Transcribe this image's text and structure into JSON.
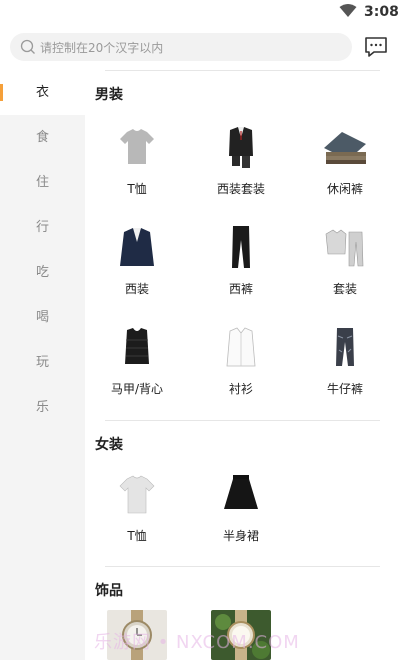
{
  "status": {
    "time": "3:08",
    "wifi_icon": "wifi-icon"
  },
  "search": {
    "placeholder": "请控制在20个汉字以内",
    "icon": "search-icon"
  },
  "message_icon": "message-icon",
  "sidebar": {
    "items": [
      {
        "label": "衣",
        "active": true
      },
      {
        "label": "食",
        "active": false
      },
      {
        "label": "住",
        "active": false
      },
      {
        "label": "行",
        "active": false
      },
      {
        "label": "吃",
        "active": false
      },
      {
        "label": "喝",
        "active": false
      },
      {
        "label": "玩",
        "active": false
      },
      {
        "label": "乐",
        "active": false
      }
    ]
  },
  "sections": [
    {
      "title": "男装",
      "items": [
        {
          "label": "T恤",
          "icon": "tshirt-icon"
        },
        {
          "label": "西装套装",
          "icon": "suit-set-icon"
        },
        {
          "label": "休闲裤",
          "icon": "casual-pants-icon"
        },
        {
          "label": "西装",
          "icon": "blazer-icon"
        },
        {
          "label": "西裤",
          "icon": "trousers-icon"
        },
        {
          "label": "套装",
          "icon": "tracksuit-icon"
        },
        {
          "label": "马甲/背心",
          "icon": "vest-icon"
        },
        {
          "label": "衬衫",
          "icon": "shirt-icon"
        },
        {
          "label": "牛仔裤",
          "icon": "jeans-icon"
        }
      ]
    },
    {
      "title": "女装",
      "items": [
        {
          "label": "T恤",
          "icon": "tshirt-icon"
        },
        {
          "label": "半身裙",
          "icon": "skirt-icon"
        }
      ]
    },
    {
      "title": "饰品",
      "items": [
        {
          "label": "",
          "icon": "watch-icon"
        },
        {
          "label": "",
          "icon": "watch-icon"
        }
      ]
    }
  ],
  "watermark": "乐游网 • NXCOM.COM",
  "colors": {
    "accent": "#f5a03a",
    "sidebar_bg": "#f4f4f4"
  }
}
